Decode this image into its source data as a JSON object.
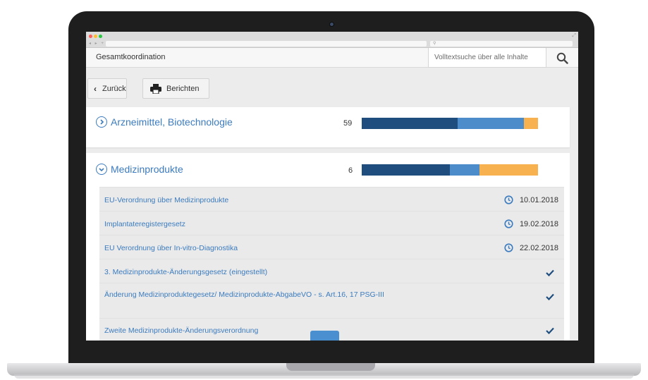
{
  "app": {
    "title": "Gesamtkoordination",
    "search_placeholder": "Volltextsuche über alle Inhalte"
  },
  "browser": {
    "nav_glyphs": "◂ ▸ +",
    "search_glyph": "⚲"
  },
  "toolbar": {
    "back_label": "Zurück",
    "report_label": "Berichten"
  },
  "colors": {
    "link": "#3b7bbf",
    "bar_dark": "#1f4e7e",
    "bar_mid": "#4d8ccb",
    "bar_orange": "#f7b24f"
  },
  "categories": [
    {
      "name": "Arzneimittel, Biotechnologie",
      "count": "59",
      "expanded": false,
      "bar": [
        0.544,
        0.376,
        0.08
      ]
    },
    {
      "name": "Medizinprodukte",
      "count": "6",
      "expanded": true,
      "bar": [
        0.5,
        0.168,
        0.332
      ]
    }
  ],
  "items": [
    {
      "title": "EU-Verordnung über Medizinprodukte",
      "date": "10.01.2018",
      "status": "clock-icon"
    },
    {
      "title": "Implantateregistergesetz",
      "date": "19.02.2018",
      "status": "clock-icon"
    },
    {
      "title": "EU Verordnung über In-vitro-Diagnostika",
      "date": "22.02.2018",
      "status": "clock-icon"
    },
    {
      "title": "3. Medizinprodukte-Änderungsgesetz (eingestellt)",
      "status": "check-icon"
    },
    {
      "title": "Änderung Medizinproduktegesetz/ Medizinprodukte-AbgabeVO - s. Art.16, 17 PSG-III",
      "status": "check-icon"
    },
    {
      "title": "Zweite Medizinprodukte-Änderungsverordnung",
      "status": "check-icon"
    }
  ]
}
